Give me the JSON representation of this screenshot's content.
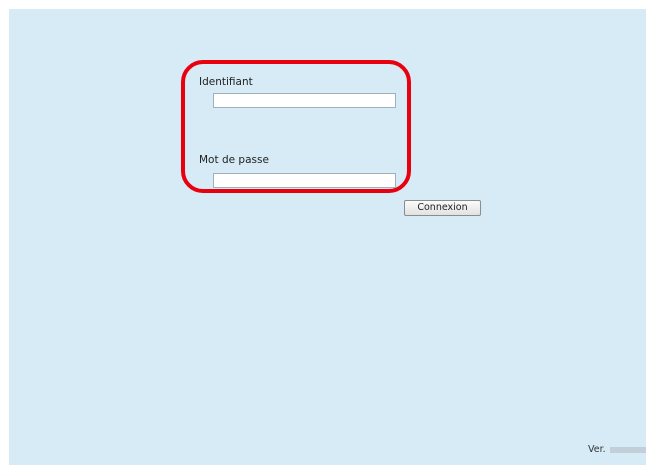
{
  "login": {
    "username_label": "Identifiant",
    "username_value": "",
    "password_label": "Mot de passe",
    "password_value": "",
    "submit_label": "Connexion"
  },
  "footer": {
    "version_label": "Ver."
  },
  "colors": {
    "background": "#d6ebf6",
    "highlight": "#e8000f"
  }
}
